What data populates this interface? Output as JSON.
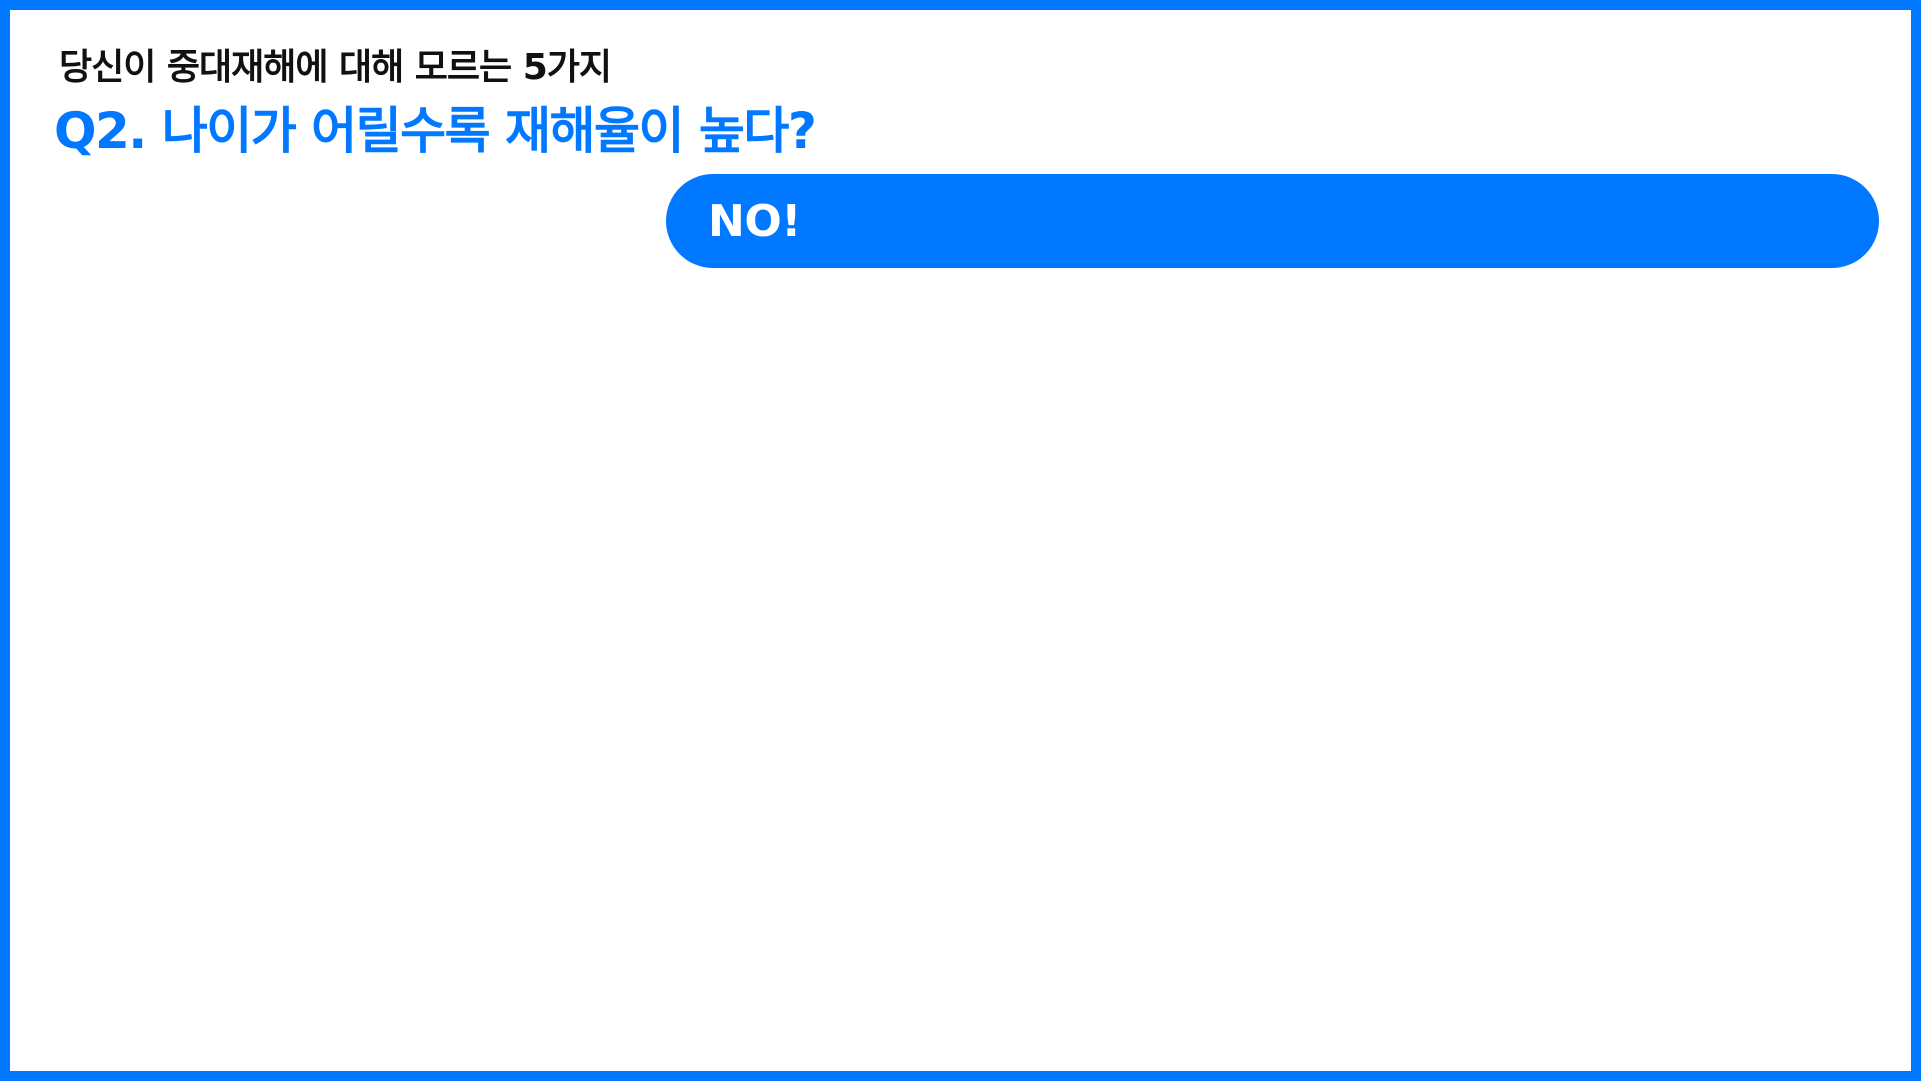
{
  "slide": {
    "subtitle": "당신이 중대재해에 대해 모르는 5가지",
    "question": "Q2. 나이가 어릴수록 재해율이 높다?",
    "answer": "NO!"
  },
  "colors": {
    "accent": "#0078ff",
    "text": "#111111",
    "background": "#ffffff"
  }
}
